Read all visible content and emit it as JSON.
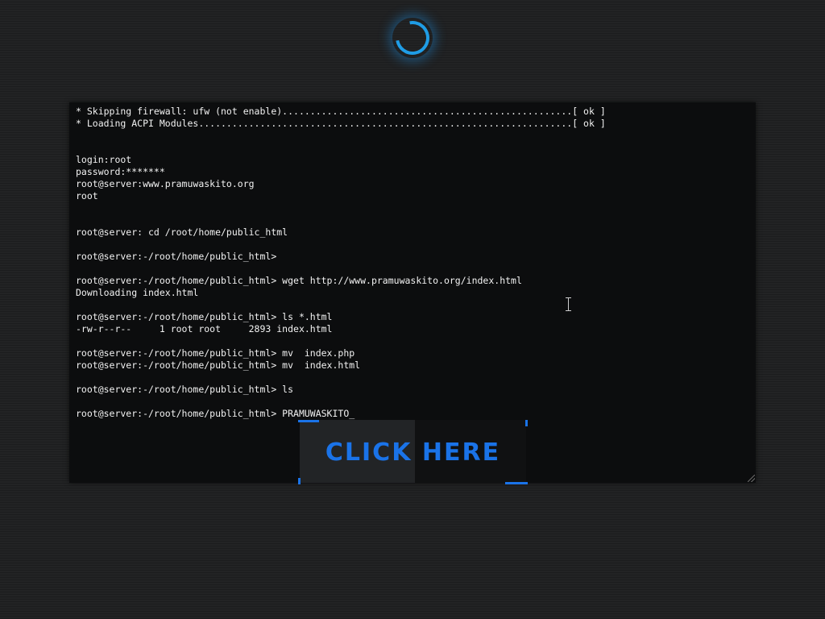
{
  "loader": {
    "icon": "spinner-icon",
    "color": "#1f9de6"
  },
  "terminal": {
    "background": "#0c0d0e",
    "text_color": "#f2f2f2",
    "lines": [
      "* Skipping firewall: ufw (not enable)....................................................[ ok ]",
      "* Loading ACPI Modules...................................................................[ ok ]",
      "",
      "",
      "login:root",
      "password:*******",
      "root@server:www.pramuwaskito.org",
      "root",
      "",
      "",
      "root@server: cd /root/home/public_html",
      "",
      "root@server:-/root/home/public_html>",
      "",
      "root@server:-/root/home/public_html> wget http://www.pramuwaskito.org/index.html",
      "Downloading index.html",
      "",
      "root@server:-/root/home/public_html> ls *.html",
      "-rw-r--r--     1 root root     2893 index.html",
      "",
      "root@server:-/root/home/public_html> mv  index.php",
      "root@server:-/root/home/public_html> mv  index.html",
      "",
      "root@server:-/root/home/public_html> ls",
      "",
      "root@server:-/root/home/public_html> PRAMUWASKITO_"
    ]
  },
  "cta": {
    "label": "CLICK HERE",
    "accent": "#1a73e8"
  },
  "pointer": {
    "icon": "text-cursor-icon"
  }
}
